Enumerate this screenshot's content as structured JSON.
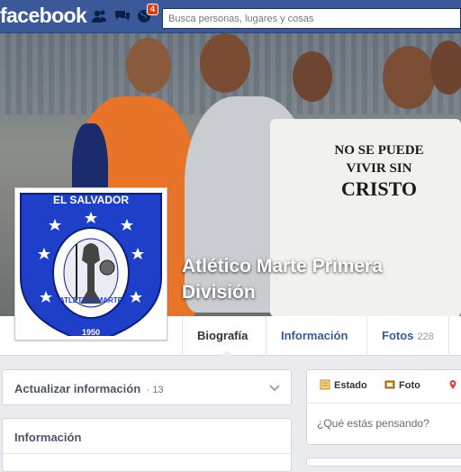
{
  "topbar": {
    "logo": "facebook",
    "notification_count": "4",
    "search_placeholder": "Busca personas, lugares y cosas"
  },
  "cover": {
    "shirt_line1": "NO SE PUEDE",
    "shirt_line2": "VIVIR SIN",
    "shirt_line3": "CRISTO",
    "page_name": "Atlético Marte Primera División"
  },
  "profile_crest": {
    "top_text": "EL SALVADOR",
    "ring_text": "ATLETICO MARTE",
    "year_fragment": "1950"
  },
  "tabs": [
    {
      "label": "Biografía"
    },
    {
      "label": "Información"
    },
    {
      "label": "Fotos",
      "count": "228"
    }
  ],
  "update_panel": {
    "label": "Actualizar información",
    "count": "· 13"
  },
  "info_panel": {
    "label": "Información"
  },
  "composer": {
    "estado": "Estado",
    "foto": "Foto",
    "lugar": "L",
    "placeholder": "¿Qué estás pensando?"
  },
  "colors": {
    "brand": "#3b5998",
    "crest_blue": "#1e3fc8",
    "badge_red": "#dd3c10"
  }
}
